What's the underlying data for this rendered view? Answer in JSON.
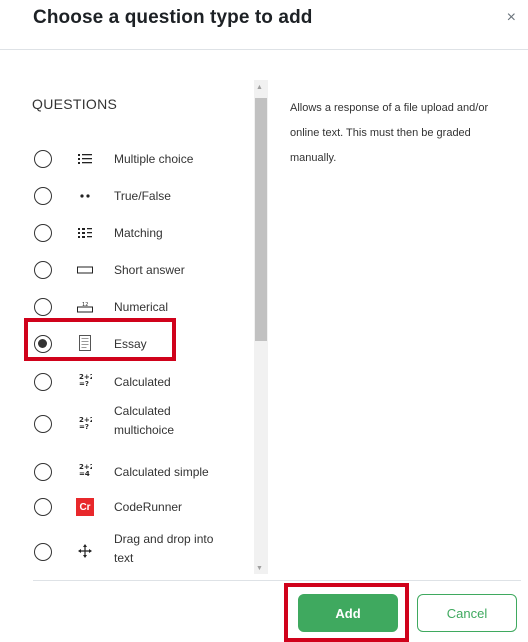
{
  "modal": {
    "title": "Choose a question type to add",
    "close_symbol": "×"
  },
  "questions": {
    "heading": "QUESTIONS",
    "selected": "Essay",
    "items": [
      {
        "label": "Multiple choice",
        "icon": "list-icon",
        "checked": false
      },
      {
        "label": "True/False",
        "icon": "dots-icon",
        "checked": false
      },
      {
        "label": "Matching",
        "icon": "grid-list-icon",
        "checked": false
      },
      {
        "label": "Short answer",
        "icon": "text-field-icon",
        "checked": false
      },
      {
        "label": "Numerical",
        "icon": "numerical-icon",
        "checked": false
      },
      {
        "label": "Essay",
        "icon": "document-icon",
        "checked": true
      },
      {
        "label": "Calculated",
        "icon": "calculated-icon",
        "checked": false
      },
      {
        "label_line1": "Calculated",
        "label_line2": "multichoice",
        "icon": "calculated-icon",
        "checked": false
      },
      {
        "label": "Calculated simple",
        "icon": "calculated-icon",
        "checked": false
      },
      {
        "label": "CodeRunner",
        "icon": "coderunner-icon",
        "icon_text": "Cr",
        "checked": false
      },
      {
        "label_line1": "Drag and drop into",
        "label_line2": "text",
        "icon": "move-icon",
        "checked": false
      }
    ]
  },
  "description": {
    "text": "Allows a response of a file upload and/or online text. This must then be graded manually."
  },
  "footer": {
    "add_label": "Add",
    "cancel_label": "Cancel"
  },
  "colors": {
    "accent": "#3fa95f",
    "highlight": "#d0021b",
    "coderunner": "#e8282b"
  }
}
